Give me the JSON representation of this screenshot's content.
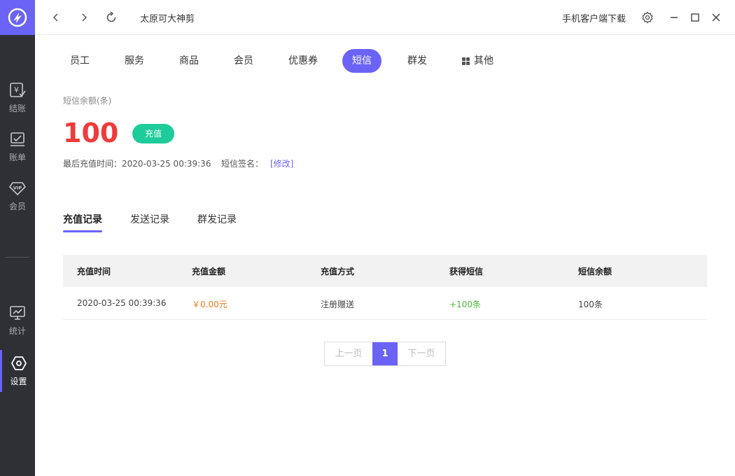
{
  "titlebar": {
    "title": "太原可大神剪",
    "download": "手机客户端下载"
  },
  "sidebar": {
    "items": [
      {
        "label": "结账",
        "icon": "checkout-icon"
      },
      {
        "label": "账单",
        "icon": "bill-icon"
      },
      {
        "label": "会员",
        "icon": "vip-icon"
      },
      {
        "label": "统计",
        "icon": "stats-icon"
      },
      {
        "label": "设置",
        "icon": "settings-icon",
        "active": true
      }
    ]
  },
  "tabs": [
    {
      "label": "员工"
    },
    {
      "label": "服务"
    },
    {
      "label": "商品"
    },
    {
      "label": "会员"
    },
    {
      "label": "优惠券"
    },
    {
      "label": "短信",
      "active": true
    },
    {
      "label": "群发"
    },
    {
      "label": "其他",
      "icon": "grid-icon"
    }
  ],
  "balance": {
    "label": "短信余额(条)",
    "value": "100",
    "recharge": "充值",
    "last_recharge": "最后充值时间：2020-03-25 00:39:36",
    "sign_label": "短信签名：",
    "edit": "[修改]"
  },
  "subtabs": [
    {
      "label": "充值记录",
      "active": true
    },
    {
      "label": "发送记录"
    },
    {
      "label": "群发记录"
    }
  ],
  "table": {
    "headers": [
      "充值时间",
      "充值金额",
      "充值方式",
      "获得短信",
      "短信余额"
    ],
    "rows": [
      [
        "2020-03-25 00:39:36",
        "￥0.00元",
        "注册赠送",
        "+100条",
        "100条"
      ]
    ]
  },
  "pagination": {
    "prev": "上一页",
    "current": "1",
    "next": "下一页"
  },
  "colors": {
    "accent": "#6a63f6",
    "sidebar": "#2e3036",
    "balance": "#f03b3b",
    "recharge": "#1ecc9a",
    "amount": "#f07a1a",
    "gain": "#4bb53a"
  }
}
